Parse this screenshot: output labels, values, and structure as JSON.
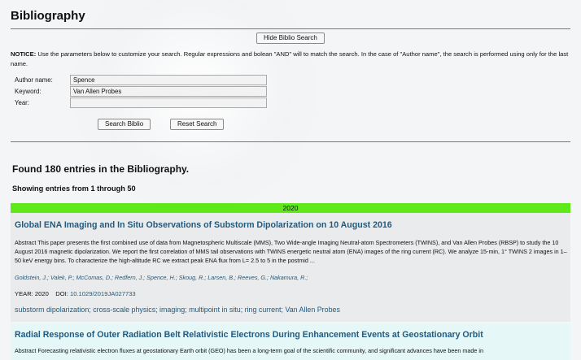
{
  "page": {
    "title": "Bibliography",
    "hide_button": "Hide Biblio Search",
    "notice_label": "NOTICE:",
    "notice_text": " Use the parameters below to customize your search. Regular expressions and bolean \"AND\" will to match the search. In the case of \"Author name\", the search is performed using only for the last name."
  },
  "form": {
    "author_label": "Author name:",
    "author_value": "Spence",
    "keyword_label": "Keyword:",
    "keyword_value": "Van Allen Probes",
    "year_label": "Year:",
    "year_value": "",
    "search_button": "Search Biblio",
    "reset_button": "Reset Search"
  },
  "results": {
    "found_text": "Found 180 entries in the Bibliography.",
    "showing_text": "Showing entries from 1 through 50",
    "year_header": "2020"
  },
  "entries": [
    {
      "title": "Global ENA Imaging and In Situ Observations of Substorm Dipolarization on 10 August 2016",
      "abstract": "Abstract This paper presents the first combined use of data from Magnetospheric Multiscale (MMS), Two Wide-angle Imaging Neutral-atom Spectrometers (TWINS), and Van Allen Probes (RBSP) to study the 10 August 2016 magnetic dipolarization. We report the first correlation of MMS tail observations with TWINS energetic neutral atom (ENA) images of the ring current (RC). We analyze 15-min, 1° TWINS 2 images in 1–50 keV energy bins. To characterize the high-altitude RC we extract peak ENA flux from L= 2.5 to 5 in the postmid ...",
      "authors": "Goldstein, J.; Valek, P.; McComas, D.; Redfern, J.; Spence, H.; Skoug, R.; Larsen, B.; Reeves, G.; Nakamura, R.;",
      "year_text": "YEAR: 2020",
      "doi_label": "DOI:",
      "doi": "10.1029/2019JA027733",
      "keywords": "substorm dipolarization; cross-scale physics; imaging; multipoint in situ; ring current; Van Allen Probes"
    },
    {
      "title": "Radial Response of Outer Radiation Belt Relativistic Electrons During Enhancement Events at Geostationary Orbit",
      "abstract": "Abstract Forecasting relativistic electron fluxes at geostationary Earth orbit (GEO) has been a long-term goal of the scientific community, and significant advances have been made in"
    }
  ],
  "colors": {
    "link": "#1f5a80",
    "year_bar": "#5fe81a",
    "entry_bg_1": "#e9ebec",
    "entry_bg_2": "#e6f7f8"
  }
}
